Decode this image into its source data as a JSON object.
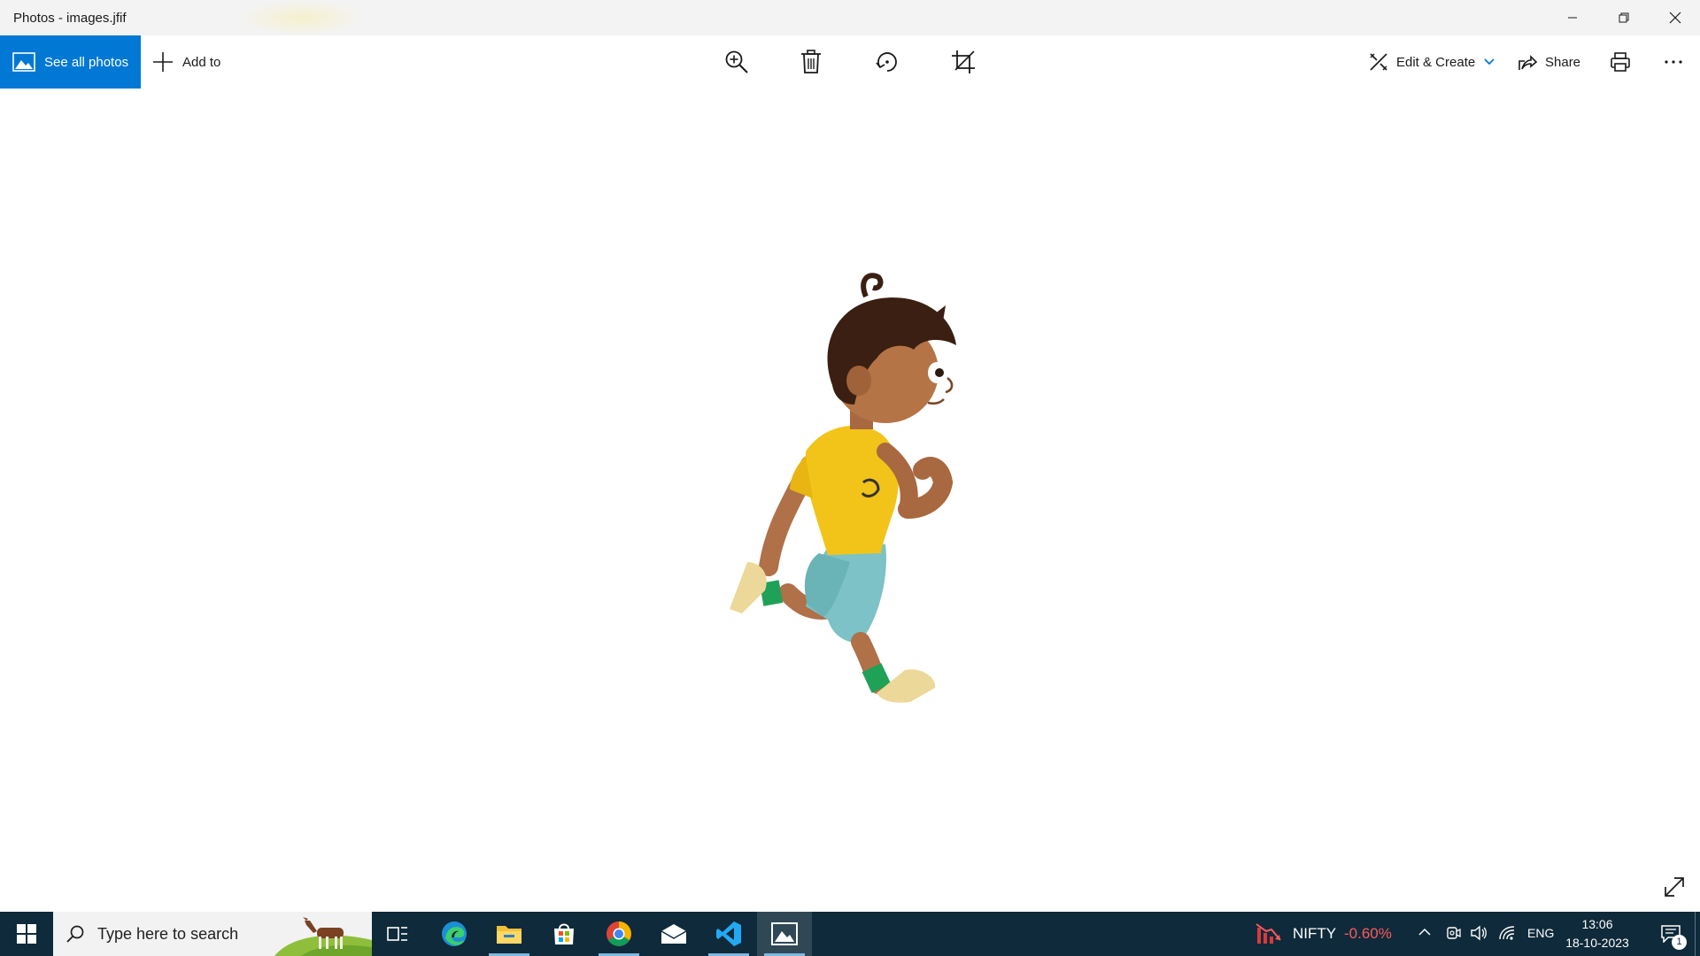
{
  "window": {
    "title": "Photos - images.jfif",
    "controls": {
      "minimize": "minimize-icon",
      "restore": "restore-icon",
      "close": "close-icon"
    }
  },
  "toolbar": {
    "see_all_photos": "See all photos",
    "add_to": "Add to",
    "zoom": "zoom-in-icon",
    "delete": "trash-icon",
    "rotate": "rotate-icon",
    "crop": "crop-icon",
    "edit_create": "Edit & Create",
    "share": "Share",
    "print": "print-icon",
    "more": "more-icon",
    "accent": "#0078d4"
  },
  "image": {
    "subject": "cartoon-running-boy-icon"
  },
  "taskbar": {
    "search_placeholder": "Type here to search",
    "apps": [
      {
        "name": "task-view",
        "icon": "task-view-icon"
      },
      {
        "name": "edge",
        "icon": "edge-icon"
      },
      {
        "name": "file-explorer",
        "icon": "folder-icon"
      },
      {
        "name": "microsoft-store",
        "icon": "store-icon"
      },
      {
        "name": "chrome",
        "icon": "chrome-icon"
      },
      {
        "name": "mail",
        "icon": "mail-icon"
      },
      {
        "name": "vscode",
        "icon": "vscode-icon"
      },
      {
        "name": "photos",
        "icon": "photos-icon"
      }
    ],
    "stock": {
      "label": "NIFTY",
      "change": "-0.60%",
      "color": "#ff5a5a"
    },
    "language": "ENG",
    "time": "13:06",
    "date": "18-10-2023",
    "notifications": "1",
    "background": "#0f2a3b"
  }
}
